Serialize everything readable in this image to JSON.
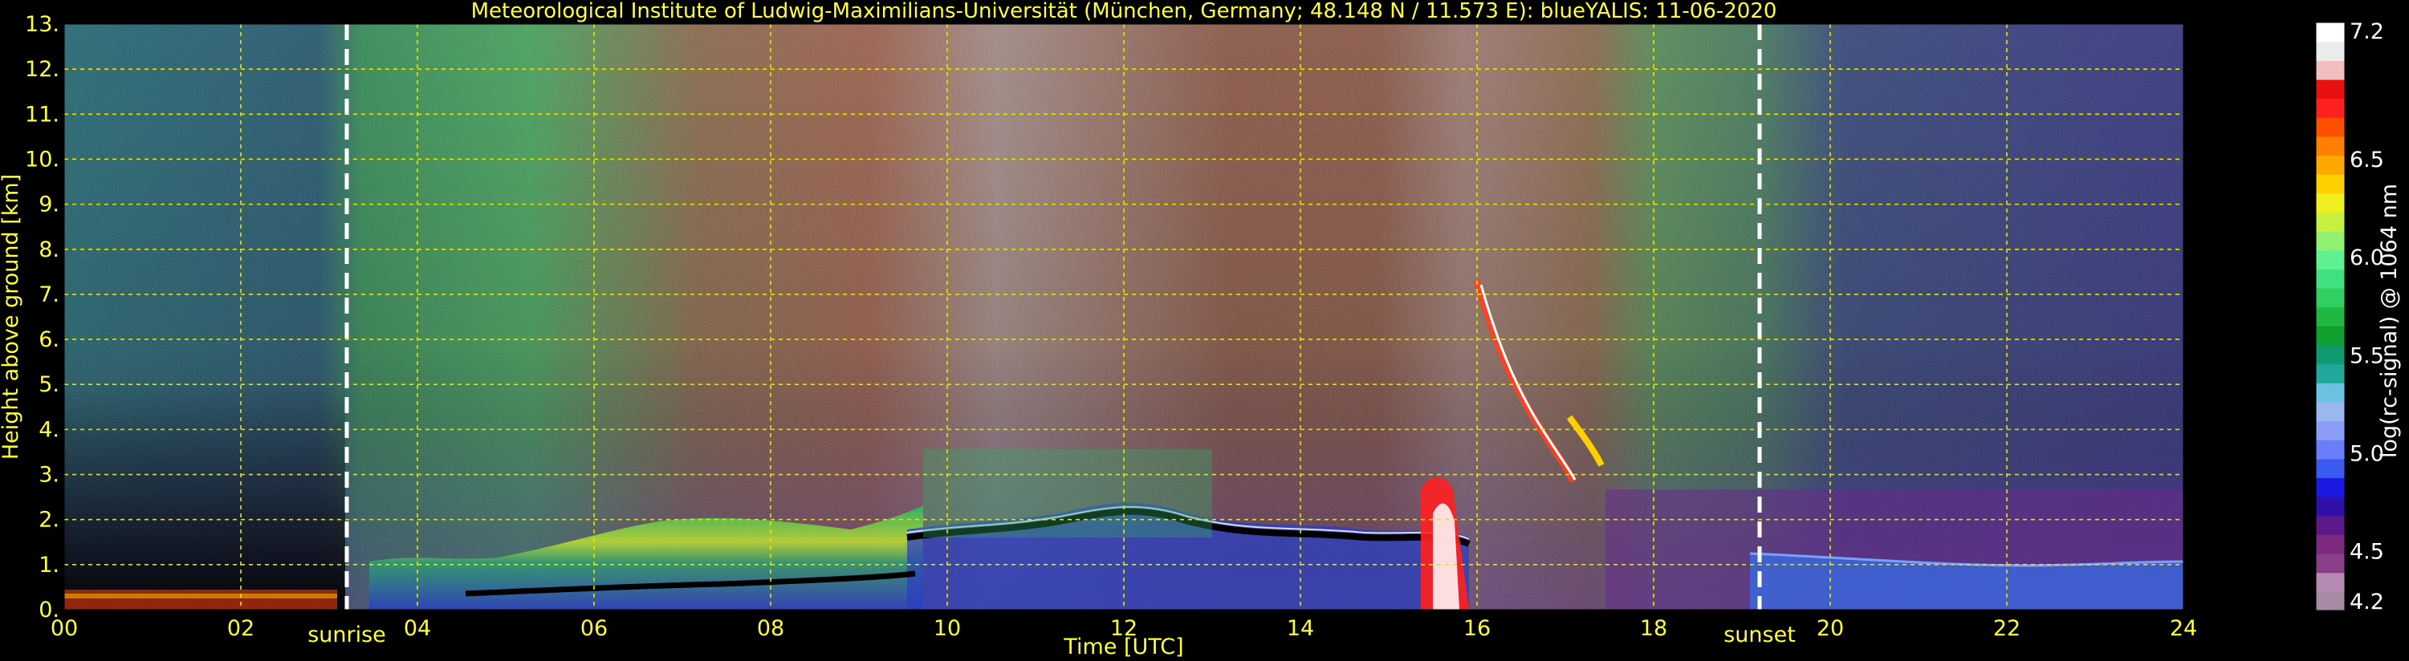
{
  "chart_data": {
    "type": "heatmap",
    "title": "Meteorological Institute of Ludwig-Maximilians-Universität (München, Germany; 48.148 N / 11.573 E):    blueYALIS: 11-06-2020",
    "xlabel": "Time [UTC]",
    "ylabel": "Height above ground [km]",
    "xlim": [
      0,
      24
    ],
    "ylim": [
      0,
      13
    ],
    "x_ticks": [
      "00",
      "02",
      "04",
      "06",
      "08",
      "10",
      "12",
      "14",
      "16",
      "18",
      "20",
      "22",
      "24"
    ],
    "y_ticks": [
      "0.",
      "1.",
      "2.",
      "3.",
      "4.",
      "5.",
      "6.",
      "7.",
      "8.",
      "9.",
      "10.",
      "11.",
      "12.",
      "13."
    ],
    "grid": true,
    "markers": [
      {
        "label": "sunrise",
        "x": 3.2
      },
      {
        "label": "sunset",
        "x": 19.2
      }
    ],
    "colorbar": {
      "label": "log(rc-signal) @ 1064 nm",
      "range": [
        4.2,
        7.2
      ],
      "ticks": [
        "7.2",
        "6.5",
        "6.0",
        "5.5",
        "5.0",
        "4.5",
        "4.2"
      ],
      "tick_values": [
        7.2,
        6.5,
        6.0,
        5.5,
        5.0,
        4.5,
        4.2
      ],
      "colors": [
        "#a68aa4",
        "#b48ab2",
        "#8a3f8a",
        "#7d2a80",
        "#5a1a88",
        "#3010a8",
        "#1a1ae0",
        "#3a5af0",
        "#6a7ef8",
        "#8a9ef8",
        "#9ab8f0",
        "#6ac2e0",
        "#20a898",
        "#0f9a70",
        "#10a030",
        "#20b840",
        "#30d060",
        "#40e080",
        "#60f090",
        "#90f070",
        "#c8f040",
        "#f0f020",
        "#ffd000",
        "#ffa800",
        "#ff8000",
        "#ff5000",
        "#ff2020",
        "#e81010",
        "#f0c0c0",
        "#ececec",
        "#ffffff"
      ]
    }
  }
}
